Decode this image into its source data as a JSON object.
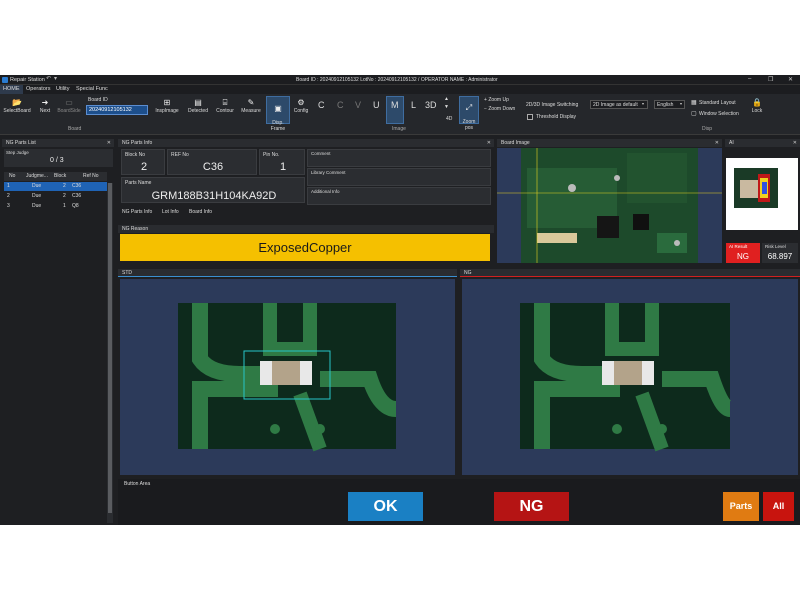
{
  "window": {
    "app_title": "Repair Station",
    "center_title": "Board ID : 20240912105132 LotNo : 20240912105132 / OPERATOR NAME : Administrator"
  },
  "tabs": [
    "HOME",
    "Operators",
    "Utility",
    "Special Func"
  ],
  "ribbon": {
    "select_board": "SelectBoard",
    "next": "Next",
    "board_side": "BoardSide",
    "board_id_label": "Board ID",
    "board_id_value": "20240912105132",
    "board_group": "Board",
    "inspimage": "InspImage",
    "detected": "Detected",
    "contour": "Contour",
    "measure": "Measure",
    "disp_frame": "Disp.\nFrame",
    "config": "Config",
    "letters": [
      "C",
      "C",
      "V",
      "U",
      "H",
      "M",
      "L",
      "3D"
    ],
    "four_d": "4D",
    "zoom_pos": "Zoom\npos",
    "zoom_up": "Zoom Up",
    "zoom_down": "Zoom Down",
    "image_group": "Image",
    "switching_label": "2D/3D Image Switching",
    "switching_value": "2D Image as default",
    "threshold": "Threshold Display",
    "language": "English",
    "standard_layout": "Standard Layout",
    "window_selection": "Window Selection",
    "lock": "Lock",
    "disp_group": "Disp"
  },
  "ng_list": {
    "title": "NG Parts List",
    "step_judge_label": "Step Judge",
    "step_judge_value": "0 / 3",
    "columns": [
      "No",
      "Judgme...",
      "Block",
      "Ref No"
    ],
    "rows": [
      {
        "no": "1",
        "judge": "Due",
        "block": "2",
        "ref": "C36"
      },
      {
        "no": "2",
        "judge": "Due",
        "block": "2",
        "ref": "C36"
      },
      {
        "no": "3",
        "judge": "Due",
        "block": "1",
        "ref": "Q8"
      }
    ]
  },
  "info": {
    "title": "NG Parts Info",
    "block_label": "Block No",
    "block_value": "2",
    "ref_label": "REF No",
    "ref_value": "C36",
    "pin_label": "Pin No.",
    "pin_value": "1",
    "parts_name_label": "Parts Name",
    "parts_name_value": "GRM188B31H104KA92D",
    "comment": "Comment",
    "library_comment": "Library Comment",
    "additional_info": "Additional Info",
    "sub_tabs": [
      "NG Parts Info",
      "Lot Info",
      "Board Info"
    ],
    "reason_label": "NG Reason",
    "reason_value": "ExposedCopper"
  },
  "board_image": {
    "title": "Board Image"
  },
  "ai": {
    "title": "AI",
    "result_label": "AI Result",
    "result_value": "NG",
    "risk_label": "Risk Level",
    "risk_value": "68.897"
  },
  "std": {
    "title": "STD"
  },
  "ng": {
    "title": "NG"
  },
  "buttons": {
    "area_label": "Button Area",
    "ok": "OK",
    "ng": "NG",
    "parts": "Parts",
    "all": "All"
  },
  "colors": {
    "reason_bg": "#f5c000",
    "ok_bg": "#1a80c4",
    "ng_bg": "#b51414",
    "parts_bg": "#e07b12",
    "all_bg": "#c8140e",
    "selected_row": "#1f63b5"
  }
}
